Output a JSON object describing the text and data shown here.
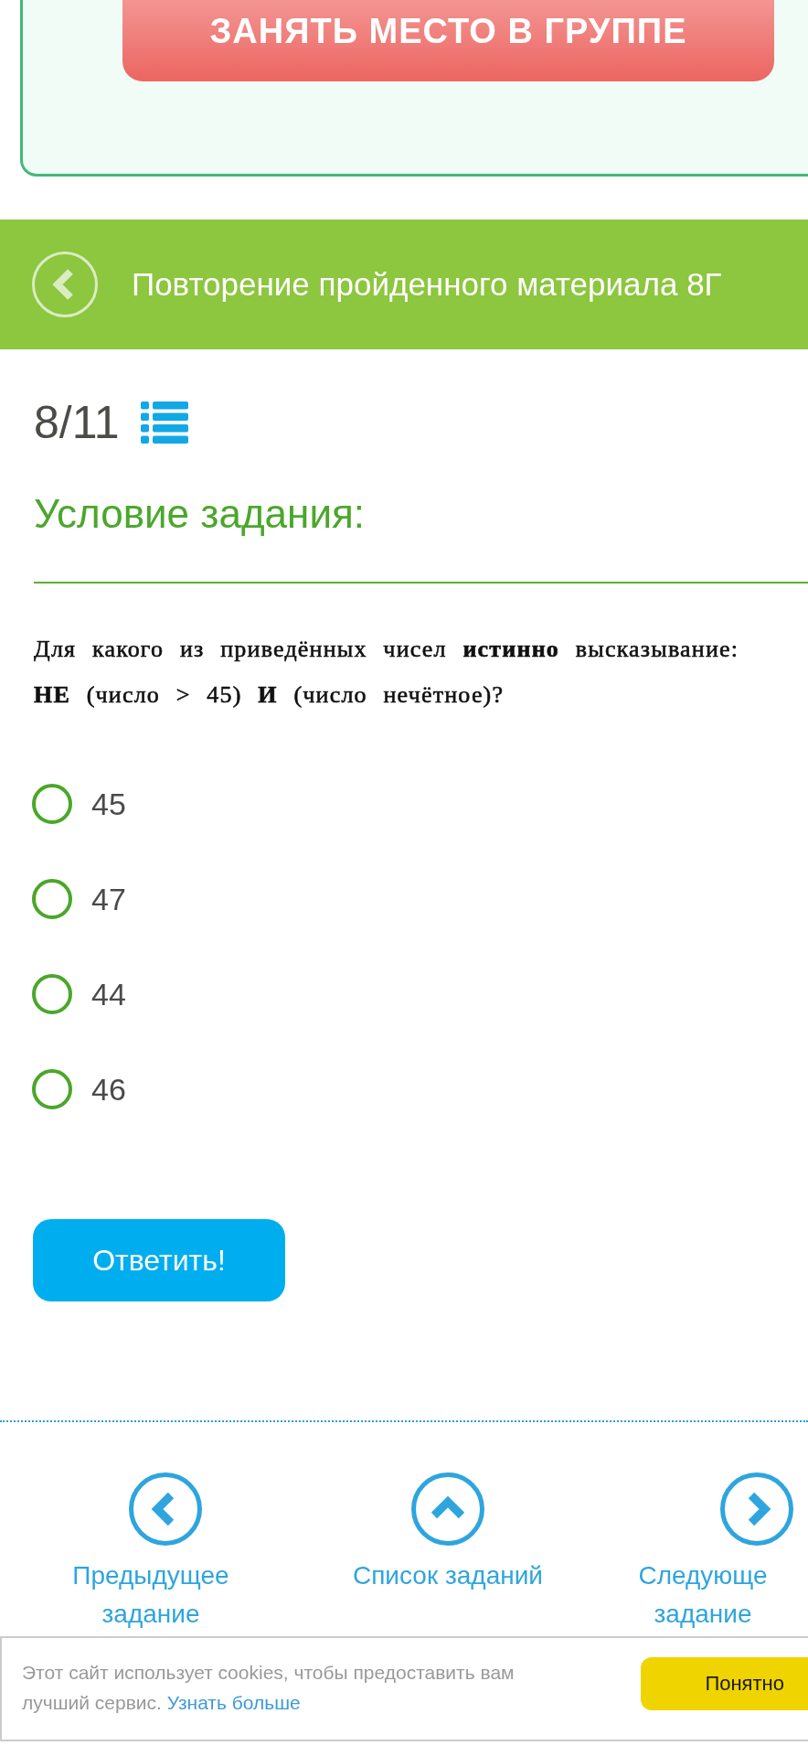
{
  "promo_banner": {
    "button": "ЗАНЯТЬ МЕСТО В ГРУППЕ"
  },
  "header": {
    "title": "Повторение пройденного материала 8Г"
  },
  "progress": {
    "counter": "8/11"
  },
  "task": {
    "heading": "Условие задания:",
    "question": "Для какого из приведённых чисел **истинно** высказывание:\n**НЕ** (число > 45) **И** (число нечётное)?",
    "options": [
      {
        "label": "45",
        "selected": false
      },
      {
        "label": "47",
        "selected": false
      },
      {
        "label": "44",
        "selected": false
      },
      {
        "label": "46",
        "selected": false
      }
    ],
    "submit_button": "Ответить!"
  },
  "navigation": [
    {
      "kind": "previous",
      "label": "Предыдущее задание"
    },
    {
      "kind": "list",
      "label": "Список заданий"
    },
    {
      "kind": "next",
      "label": "Следующе задание"
    }
  ],
  "cookie_notice": {
    "text": "Этот сайт использует cookies, чтобы предоставить вам лучший сервис.",
    "link": "Узнать больше",
    "button": "Понятно"
  }
}
